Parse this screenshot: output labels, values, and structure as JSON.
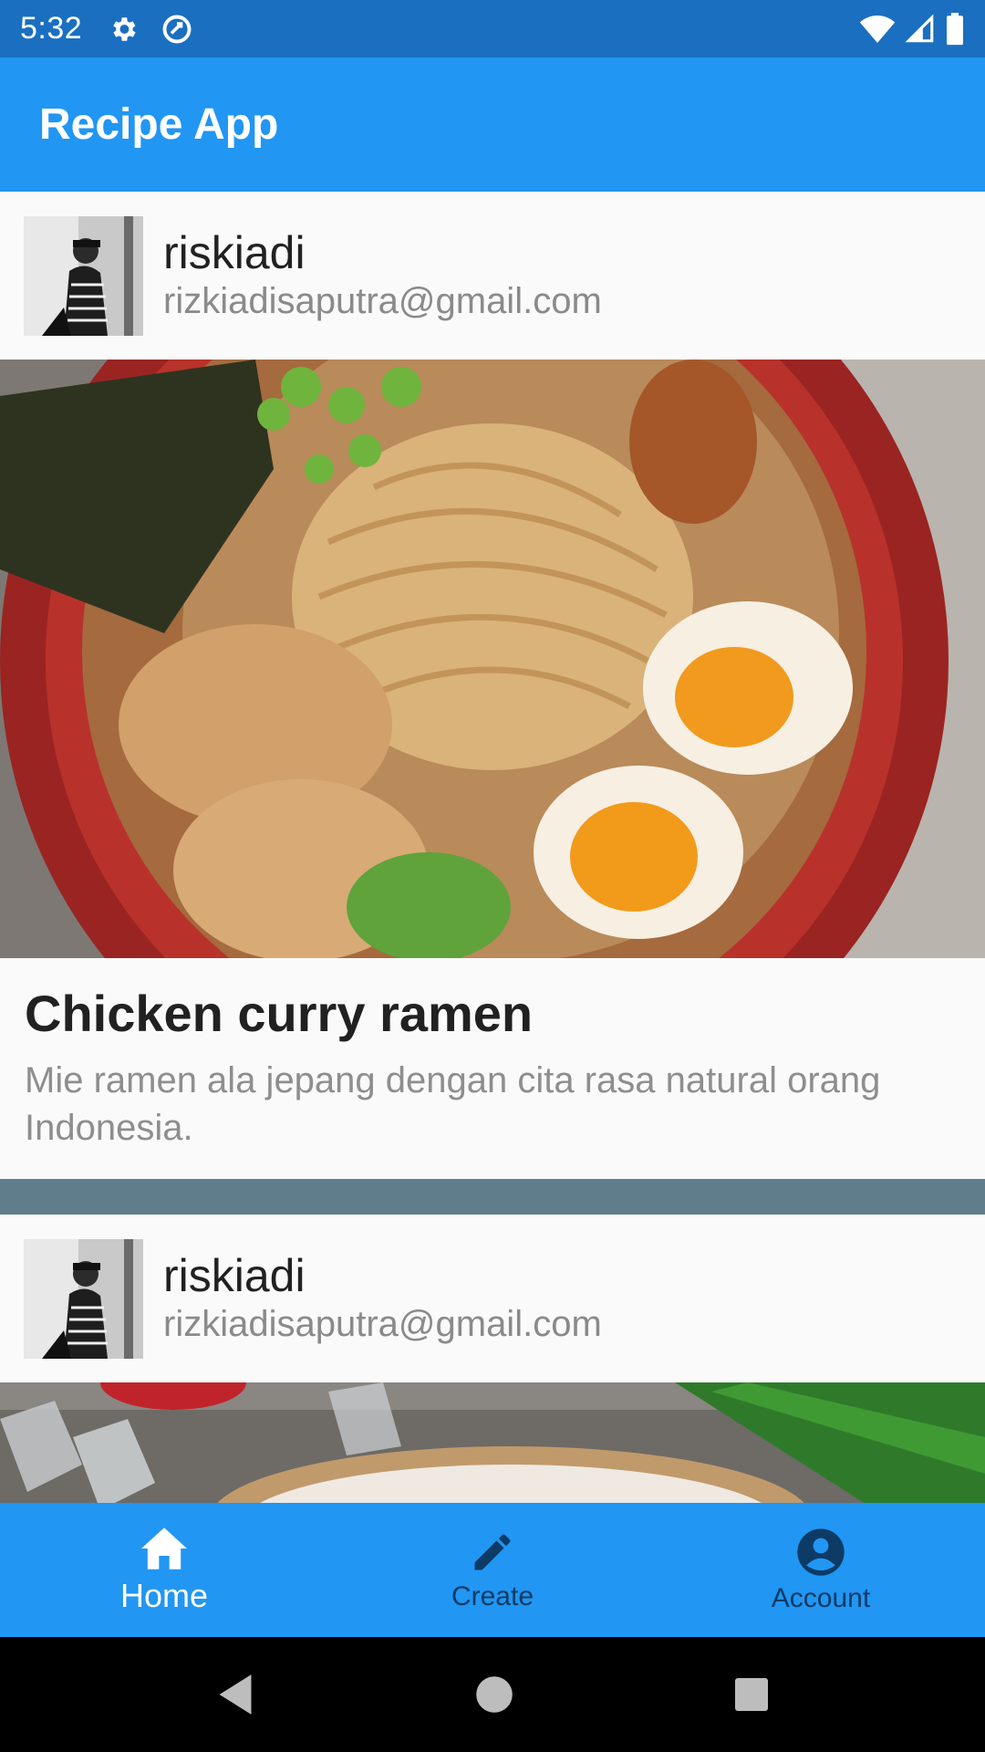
{
  "status_bar": {
    "time": "5:32",
    "icons": [
      "gear-icon",
      "sync-icon",
      "wifi-icon",
      "signal-icon",
      "battery-icon"
    ]
  },
  "app_bar": {
    "title": "Recipe App"
  },
  "feed": {
    "posts": [
      {
        "author": {
          "name": "riskiadi",
          "email": "rizkiadisaputra@gmail.com"
        },
        "title": "Chicken curry ramen",
        "description": "Mie ramen ala jepang dengan cita rasa natural orang Indonesia."
      },
      {
        "author": {
          "name": "riskiadi",
          "email": "rizkiadisaputra@gmail.com"
        }
      }
    ]
  },
  "bottom_nav": {
    "items": [
      {
        "label": "Home",
        "icon": "home-icon",
        "active": true
      },
      {
        "label": "Create",
        "icon": "pencil-icon",
        "active": false
      },
      {
        "label": "Account",
        "icon": "account-icon",
        "active": false
      }
    ]
  },
  "colors": {
    "status_bar": "#1a6fc1",
    "primary": "#2196f3",
    "divider": "#607d8b",
    "inactive_nav": "#0d3b66"
  }
}
